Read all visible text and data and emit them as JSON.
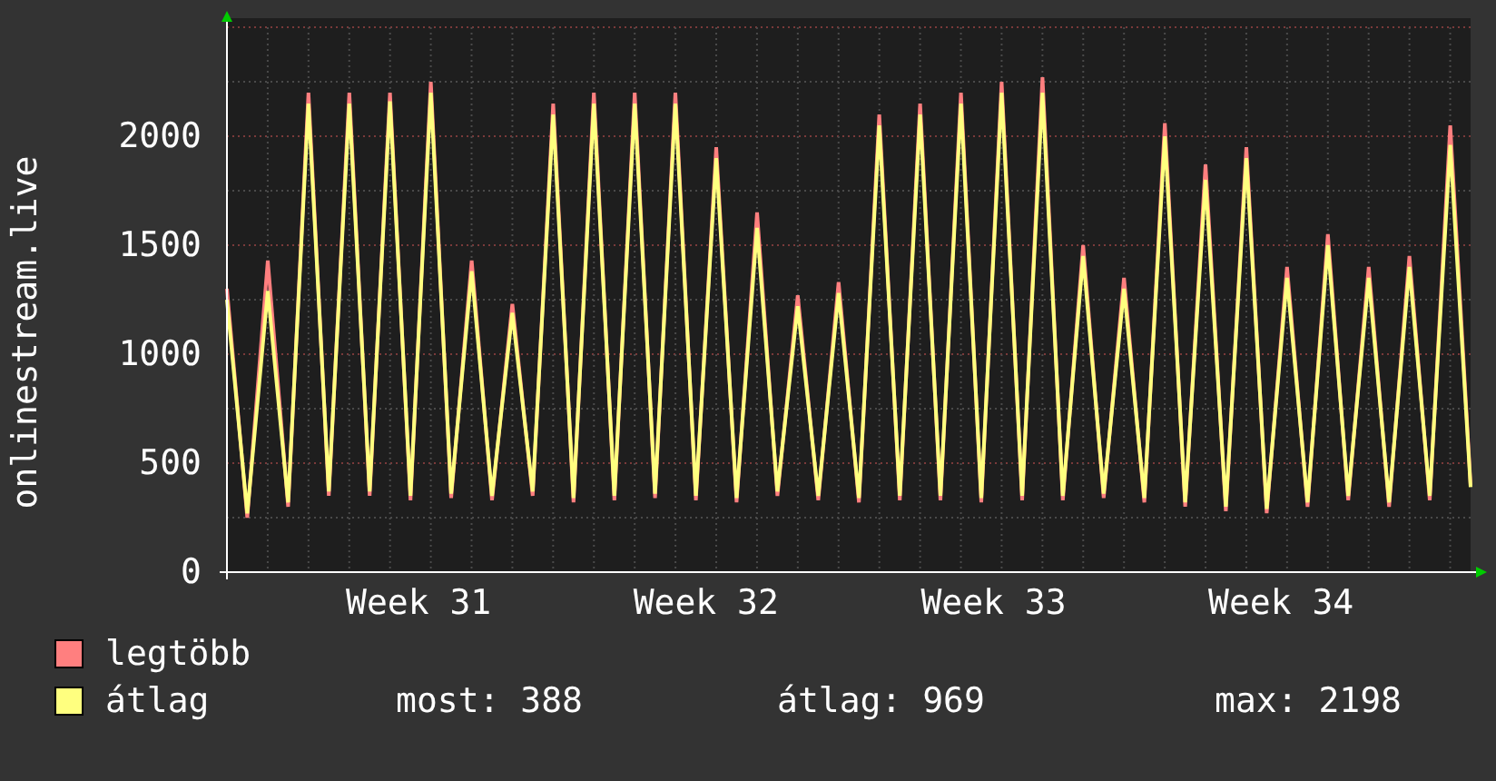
{
  "chart": {
    "chart_data": {
      "type": "line",
      "ylabel": "onlinestream.live",
      "ylim": [
        0,
        2500
      ],
      "yticks": [
        0,
        500,
        1000,
        1500,
        2000
      ],
      "grid": true,
      "series": [
        {
          "name": "legtöbb",
          "color": "#ff7f7f",
          "values": [
            1300,
            250,
            1430,
            300,
            2200,
            350,
            2200,
            350,
            2200,
            330,
            2250,
            340,
            1430,
            330,
            1230,
            350,
            2150,
            320,
            2200,
            330,
            2200,
            340,
            2200,
            330,
            1950,
            320,
            1650,
            350,
            1270,
            330,
            1330,
            320,
            2100,
            330,
            2150,
            330,
            2200,
            320,
            2250,
            330,
            2270,
            330,
            1500,
            340,
            1350,
            320,
            2060,
            300,
            1870,
            280,
            1950,
            270,
            1400,
            300,
            1550,
            330,
            1400,
            300,
            1450,
            330,
            2050,
            400
          ]
        },
        {
          "name": "átlag",
          "color": "#ffff7f",
          "values": [
            1250,
            270,
            1290,
            320,
            2150,
            370,
            2150,
            370,
            2160,
            350,
            2200,
            360,
            1380,
            350,
            1190,
            370,
            2100,
            340,
            2150,
            350,
            2150,
            360,
            2150,
            350,
            1900,
            340,
            1580,
            370,
            1220,
            350,
            1280,
            340,
            2050,
            350,
            2100,
            350,
            2150,
            340,
            2200,
            350,
            2200,
            350,
            1450,
            360,
            1300,
            340,
            2000,
            320,
            1800,
            300,
            1900,
            290,
            1350,
            320,
            1500,
            350,
            1350,
            320,
            1400,
            350,
            1960,
            390
          ]
        }
      ]
    },
    "week_labels": [
      "Week 31",
      "Week 32",
      "Week 33",
      "Week 34"
    ]
  },
  "stats": [
    "most: 388",
    "átlag: 969",
    "max: 2198"
  ]
}
